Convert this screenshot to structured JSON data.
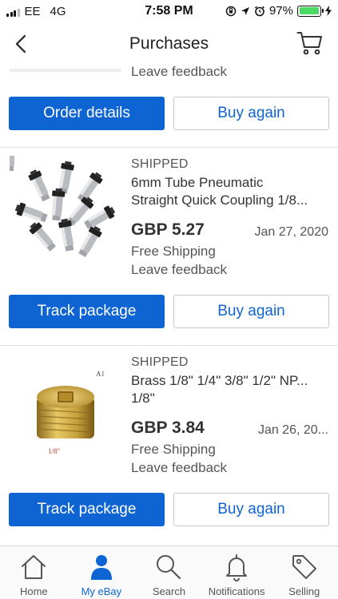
{
  "status_bar": {
    "carrier": "EE",
    "network": "4G",
    "time": "7:58 PM",
    "battery": "97%",
    "battery_level": 0.97
  },
  "nav": {
    "title": "Purchases",
    "back_icon": "chevron-left-icon",
    "cart_icon": "cart-icon"
  },
  "partial_order": {
    "feedback": "Leave feedback",
    "primary_button": "Order details",
    "secondary_button": "Buy again"
  },
  "orders": [
    {
      "status": "SHIPPED",
      "title_line1": "6mm Tube Pneumatic",
      "title_line2": "Straight Quick Coupling 1/8...",
      "price": "GBP 5.27",
      "date": "Jan 27, 2020",
      "shipping": "Free Shipping",
      "feedback": "Leave feedback",
      "primary_button": "Track package",
      "secondary_button": "Buy again"
    },
    {
      "status": "SHIPPED",
      "title_line1": "Brass 1/8\" 1/4\" 3/8\" 1/2\" NP...",
      "title_line2": "1/8\"",
      "price": "GBP 3.84",
      "date": "Jan 26, 20...",
      "shipping": "Free Shipping",
      "feedback": "Leave feedback",
      "primary_button": "Track package",
      "secondary_button": "Buy again",
      "image_label_a": "A1",
      "image_label_b": "1/8\""
    }
  ],
  "tabs": [
    {
      "label": "Home",
      "icon": "home-icon"
    },
    {
      "label": "My eBay",
      "icon": "person-icon"
    },
    {
      "label": "Search",
      "icon": "search-icon"
    },
    {
      "label": "Notifications",
      "icon": "bell-icon"
    },
    {
      "label": "Selling",
      "icon": "tag-icon"
    }
  ],
  "colors": {
    "accent": "#0e64d2",
    "battery_green": "#4cd964"
  }
}
